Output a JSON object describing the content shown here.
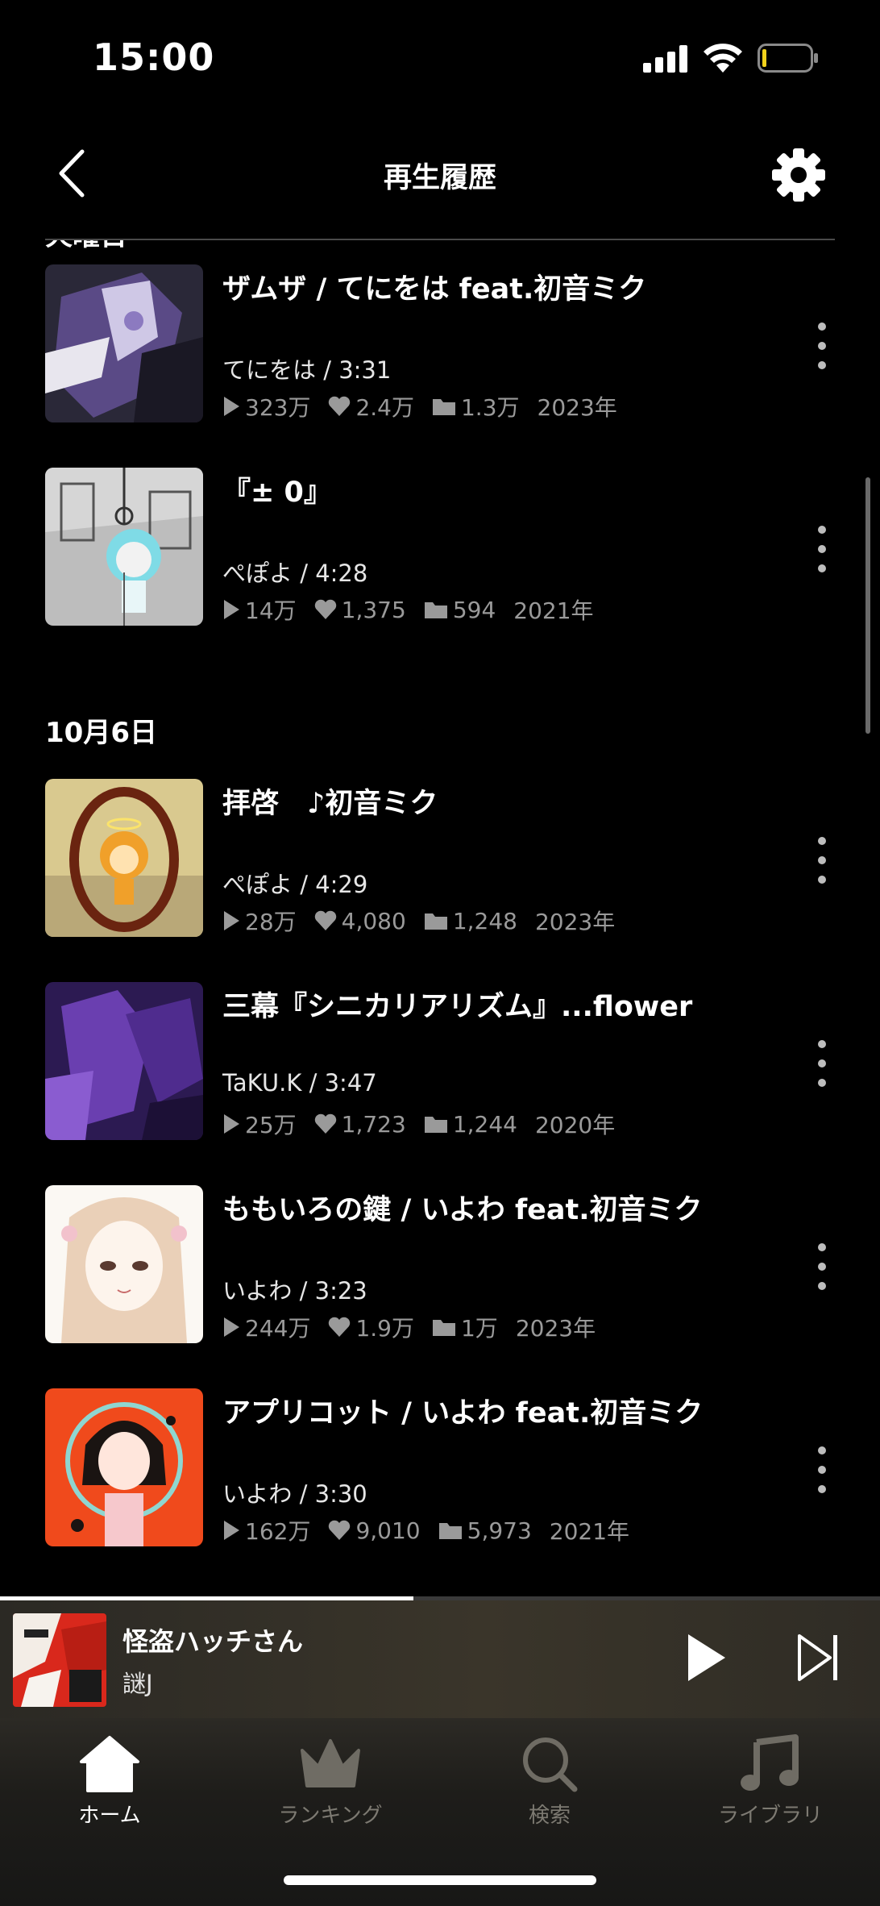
{
  "status_bar": {
    "time": "15:00"
  },
  "header": {
    "title": "再生履歴"
  },
  "sections": [
    {
      "date": "火曜日",
      "tracks": [
        {
          "title": "ザムザ / てにをは feat.初音ミク",
          "meta": "てにをは / 3:31",
          "plays": "323万",
          "likes": "2.4万",
          "mylists": "1.3万",
          "year": "2023年"
        },
        {
          "title": "『± 0』",
          "meta": "ぺぽよ / 4:28",
          "plays": "14万",
          "likes": "1,375",
          "mylists": "594",
          "year": "2021年"
        }
      ]
    },
    {
      "date": "10月6日",
      "tracks": [
        {
          "title": "拝啓　♪初音ミク",
          "meta": "ぺぽよ / 4:29",
          "plays": "28万",
          "likes": "4,080",
          "mylists": "1,248",
          "year": "2023年"
        },
        {
          "title": "三幕『シニカリアリズム』...flower",
          "meta": "TaKU.K / 3:47",
          "plays": "25万",
          "likes": "1,723",
          "mylists": "1,244",
          "year": "2020年"
        },
        {
          "title": "ももいろの鍵 / いよわ feat.初音ミク",
          "meta": "いよわ / 3:23",
          "plays": "244万",
          "likes": "1.9万",
          "mylists": "1万",
          "year": "2023年"
        },
        {
          "title": "アプリコット / いよわ feat.初音ミク",
          "meta": "いよわ / 3:30",
          "plays": "162万",
          "likes": "9,010",
          "mylists": "5,973",
          "year": "2021年"
        }
      ]
    }
  ],
  "now_playing": {
    "title": "怪盗ハッチさん",
    "artist": "謎J",
    "progress": 0.47
  },
  "tabs": [
    {
      "label": "ホーム",
      "icon": "home-icon",
      "active": true
    },
    {
      "label": "ランキング",
      "icon": "crown-icon",
      "active": false
    },
    {
      "label": "検索",
      "icon": "search-icon",
      "active": false
    },
    {
      "label": "ライブラリ",
      "icon": "music-note-icon",
      "active": false
    }
  ],
  "colors": {
    "background": "#000000",
    "secondary_text": "#9a9a9a",
    "inactive_tab": "#7d7a72"
  }
}
